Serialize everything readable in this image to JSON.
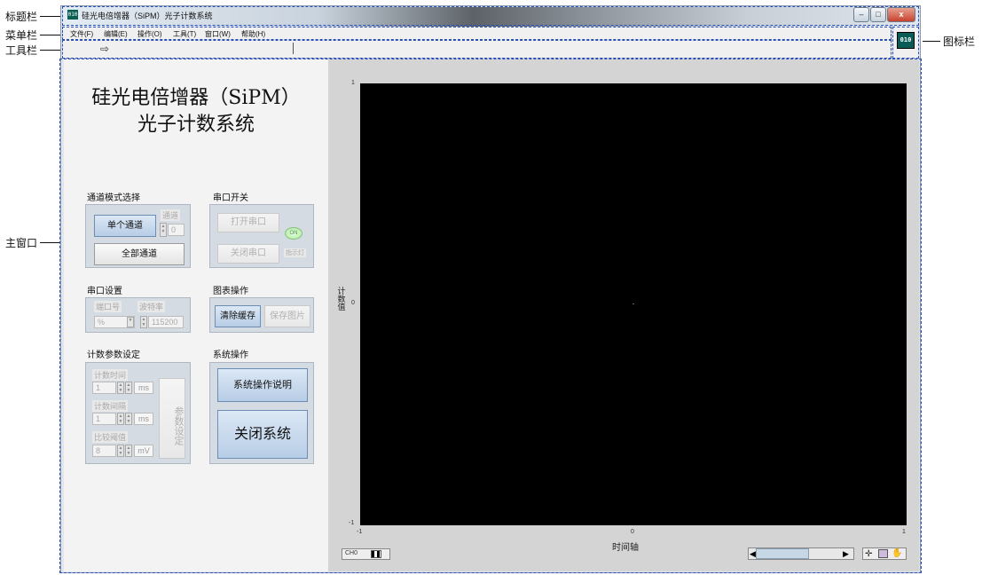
{
  "annotations": {
    "title_bar": "标题栏",
    "menu_bar": "菜单栏",
    "toolbar": "工具栏",
    "main_window": "主窗口",
    "icon_bar": "图标栏"
  },
  "window": {
    "title": "硅光电倍增器（SiPM）光子计数系统",
    "icon_text": "010",
    "controls": {
      "minimize": "–",
      "maximize": "□",
      "close": "x"
    }
  },
  "menu": [
    "文件(F)",
    "编辑(E)",
    "操作(O)",
    "工具(T)",
    "窗口(W)",
    "帮助(H)"
  ],
  "toolbar": {
    "run_icon": "run-arrow-icon",
    "run_glyph": "⇨"
  },
  "vi_icon_text": "010",
  "panel": {
    "title_line1": "硅光电倍增器（SiPM）",
    "title_line2": "光子计数系统",
    "channel_mode": {
      "label": "通道模式选择",
      "single": "单个通道",
      "all": "全部通道",
      "channel_label": "通道",
      "channel_value": "0"
    },
    "serial_switch": {
      "label": "串口开关",
      "open": "打开串口",
      "close": "关闭串口",
      "led_text": "ON",
      "led_label": "指示灯"
    },
    "serial_settings": {
      "label": "串口设置",
      "port_label": "端口号",
      "port_value": "%",
      "baud_label": "波特率",
      "baud_value": "115200"
    },
    "chart_ops": {
      "label": "图表操作",
      "clear": "清除缓存",
      "save": "保存图片"
    },
    "count_params": {
      "label": "计数参数设定",
      "time_label": "计数时间",
      "time_value": "1",
      "time_unit": "ms",
      "interval_label": "计数间隔",
      "interval_value": "1",
      "interval_unit": "ms",
      "threshold_label": "比较阈值",
      "threshold_value": "8",
      "threshold_unit": "mV",
      "set_button": "参数设定"
    },
    "system_ops": {
      "label": "系统操作",
      "help": "系统操作说明",
      "close": "关闭系统"
    }
  },
  "graph": {
    "y_label": "计数值",
    "x_label": "时间轴",
    "channel_legend": "CH0",
    "scroll_left": "◀",
    "scroll_right": "▶"
  },
  "chart_data": {
    "type": "line",
    "xlabel": "时间轴",
    "ylabel": "计数值",
    "xlim": [
      -1,
      1
    ],
    "ylim": [
      -1,
      1
    ],
    "x_ticks": [
      "-1",
      "0",
      "1"
    ],
    "y_ticks": [
      "1",
      "0",
      "-1"
    ],
    "series": [
      {
        "values": []
      }
    ],
    "background": "#000000"
  }
}
